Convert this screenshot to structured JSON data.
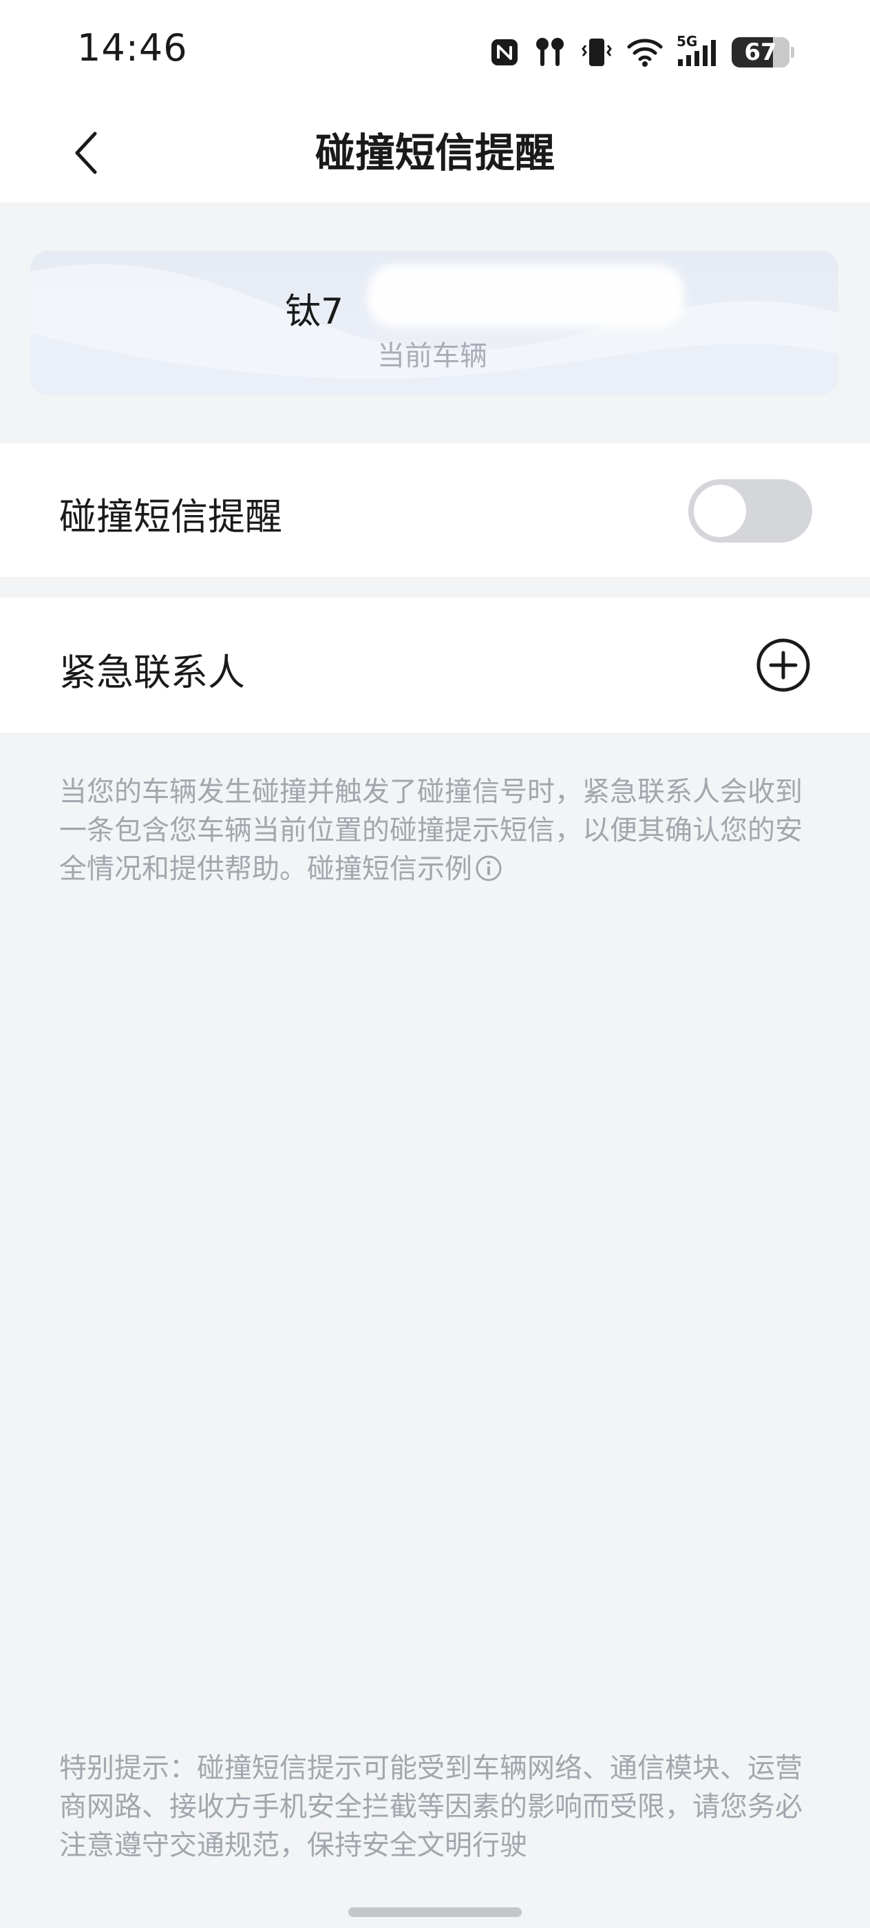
{
  "status_bar": {
    "time": "14:46",
    "network": "5G",
    "battery": "67",
    "icons": [
      "nfc-icon",
      "earbuds-icon",
      "vibrate-icon",
      "wifi-icon",
      "signal-icon",
      "battery-icon"
    ]
  },
  "header": {
    "title": "碰撞短信提醒",
    "back_icon": "chevron-left-icon"
  },
  "vehicle_card": {
    "name": "钛7",
    "subtitle": "当前车辆"
  },
  "crash_sms": {
    "label": "碰撞短信提醒",
    "enabled": false
  },
  "emergency_contact": {
    "label": "紧急联系人",
    "add_icon": "plus-circle-icon"
  },
  "description": {
    "text": "当您的车辆发生碰撞并触发了碰撞信号时，紧急联系人会收到一条包含您车辆当前位置的碰撞提示短信，以便其确认您的安全情况和提供帮助。",
    "link_text": "碰撞短信示例",
    "link_icon": "info-circle-icon"
  },
  "notice": {
    "text": "特别提示：碰撞短信提示可能受到车辆网络、通信模块、运营商网路、接收方手机安全拦截等因素的影响而受限，请您务必注意遵守交通规范，保持安全文明行驶"
  },
  "colors": {
    "background": "#f3f4f6",
    "card": "#ffffff",
    "toggle_off": "#d5d6da",
    "muted_text": "#a2a6ad"
  }
}
